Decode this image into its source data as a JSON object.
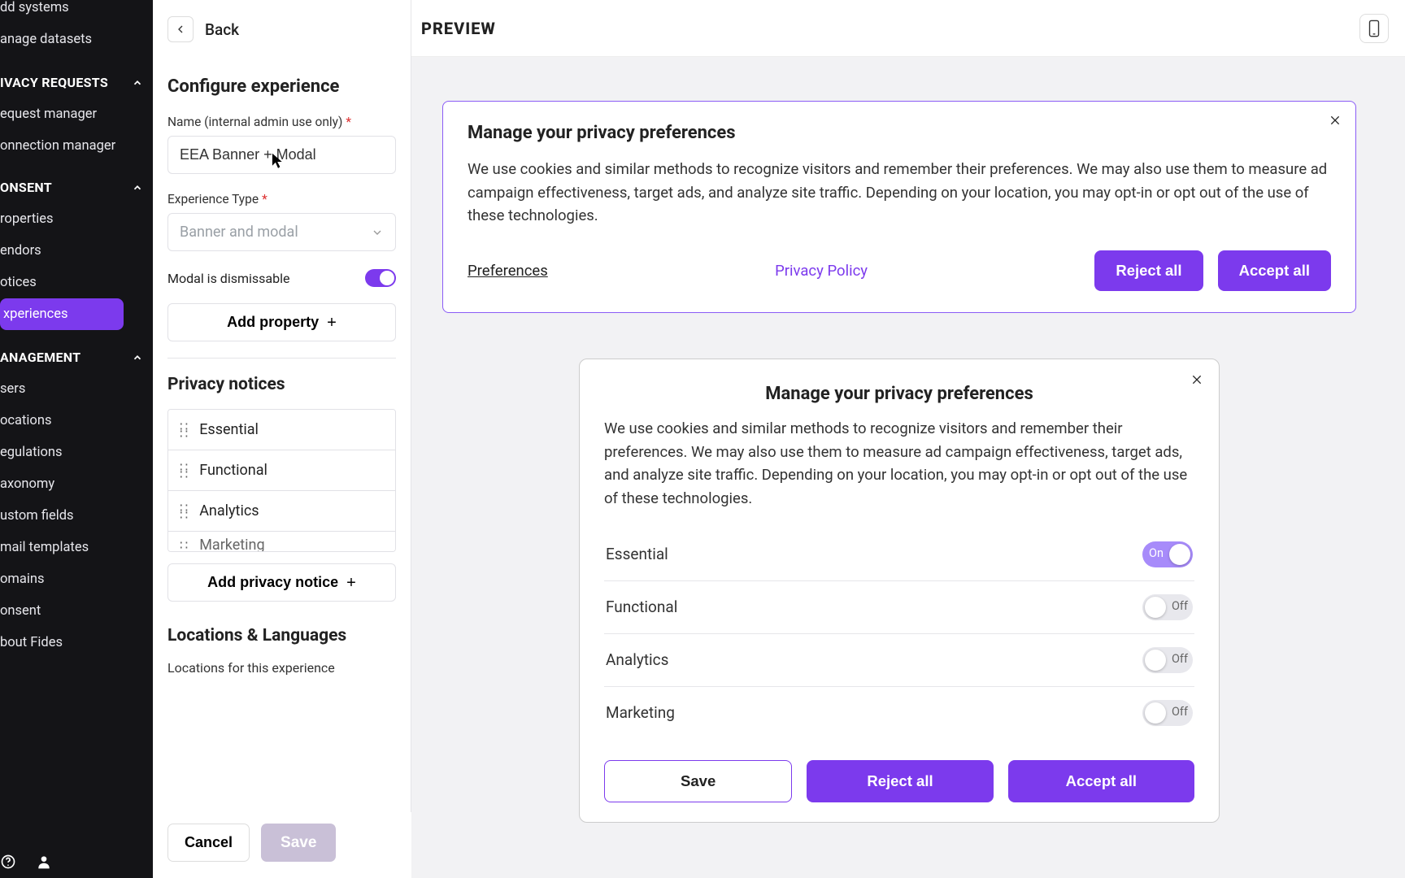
{
  "sidebar": {
    "top_items": [
      "dd systems",
      "anage datasets"
    ],
    "sections": [
      {
        "header": "IVACY REQUESTS",
        "items": [
          "equest manager",
          "onnection manager"
        ]
      },
      {
        "header": "ONSENT",
        "items": [
          "roperties",
          "endors",
          "otices",
          "xperiences"
        ],
        "active_index": 3
      },
      {
        "header": "ANAGEMENT",
        "items": [
          "sers",
          "ocations",
          "egulations",
          "axonomy",
          "ustom fields",
          "mail templates",
          "omains",
          "onsent",
          "bout Fides"
        ]
      }
    ]
  },
  "config": {
    "back_label": "Back",
    "title": "Configure experience",
    "name_label": "Name (internal admin use only)",
    "name_value": "EEA Banner + Modal",
    "type_label": "Experience Type",
    "type_value": "Banner and modal",
    "dismissable_label": "Modal is dismissable",
    "add_property_label": "Add property",
    "notices_title": "Privacy notices",
    "notices": [
      "Essential",
      "Functional",
      "Analytics",
      "Marketing"
    ],
    "add_notice_label": "Add privacy notice",
    "locations_title": "Locations & Languages",
    "locations_label": "Locations for this experience",
    "cancel_label": "Cancel",
    "save_label": "Save"
  },
  "preview": {
    "header_label": "PREVIEW",
    "banner": {
      "title": "Manage your privacy preferences",
      "body": "We use cookies and similar methods to recognize visitors and remember their preferences. We may also use them to measure ad campaign effectiveness, target ads, and analyze site traffic. Depending on your location, you may opt-in or opt out of the use of these technologies.",
      "preferences_label": "Preferences",
      "policy_label": "Privacy Policy",
      "reject_label": "Reject all",
      "accept_label": "Accept all"
    },
    "modal": {
      "title": "Manage your privacy preferences",
      "body": "We use cookies and similar methods to recognize visitors and remember their preferences. We may also use them to measure ad campaign effectiveness, target ads, and analyze site traffic. Depending on your location, you may opt-in or opt out of the use of these technologies.",
      "categories": [
        {
          "name": "Essential",
          "state": "On"
        },
        {
          "name": "Functional",
          "state": "Off"
        },
        {
          "name": "Analytics",
          "state": "Off"
        },
        {
          "name": "Marketing",
          "state": "Off"
        }
      ],
      "save_label": "Save",
      "reject_label": "Reject all",
      "accept_label": "Accept all"
    }
  }
}
